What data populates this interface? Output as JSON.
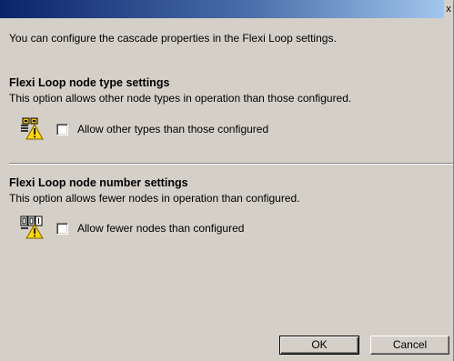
{
  "titlebar": {
    "close_label": "x"
  },
  "intro": "You can configure the cascade properties in the Flexi Loop settings.",
  "node_type": {
    "heading": "Flexi Loop node type settings",
    "description": "This option allows other node types in operation than those configured.",
    "checkbox_label": "Allow other types than those configured",
    "checked": false,
    "icon": "node-type-warning-icon"
  },
  "node_number": {
    "heading": "Flexi Loop node number settings",
    "description": "This option allows fewer nodes in operation than configured.",
    "checkbox_label": "Allow fewer nodes than configured",
    "checked": false,
    "icon": "node-number-warning-icon"
  },
  "buttons": {
    "ok": "OK",
    "cancel": "Cancel"
  },
  "colors": {
    "dialog_bg": "#d4d0c8",
    "titlebar_dark": "#0a246a",
    "titlebar_light": "#a6caf0",
    "warning_yellow": "#ffd800"
  }
}
